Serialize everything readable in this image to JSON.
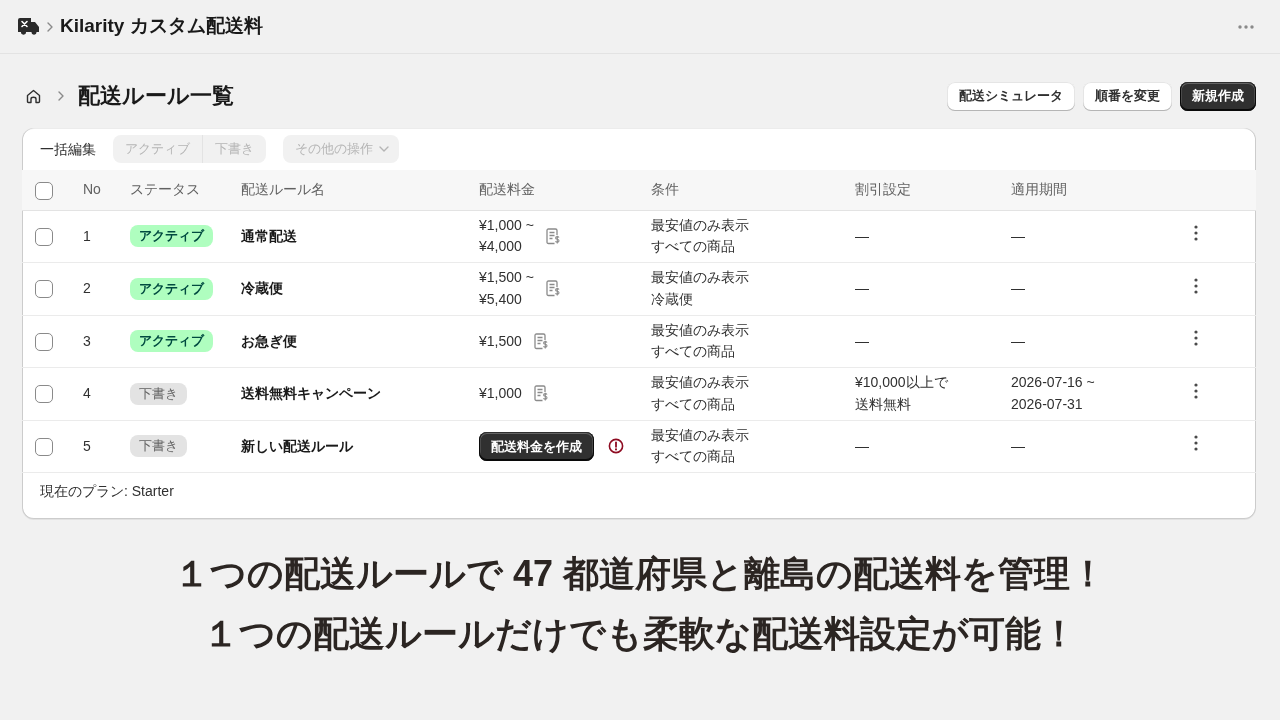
{
  "app_bar": {
    "title": "Kilarity カスタム配送料"
  },
  "page": {
    "title": "配送ルール一覧",
    "actions": [
      {
        "label": "配送シミュレータ",
        "kind": "secondary"
      },
      {
        "label": "順番を変更",
        "kind": "secondary"
      },
      {
        "label": "新規作成",
        "kind": "primary"
      }
    ]
  },
  "bulk_bar": {
    "label": "一括編集",
    "status_buttons": [
      {
        "label": "アクティブ",
        "disabled": true
      },
      {
        "label": "下書き",
        "disabled": true
      }
    ],
    "more_button": {
      "label": "その他の操作",
      "disabled": true
    }
  },
  "table": {
    "select_all": {
      "checked": false
    },
    "columns": [
      "No",
      "ステータス",
      "配送ルール名",
      "配送料金",
      "条件",
      "割引設定",
      "適用期間"
    ],
    "rows": [
      {
        "checked": false,
        "no": "1",
        "status": {
          "label": "アクティブ",
          "kind": "active"
        },
        "name": "通常配送",
        "fee": {
          "kind": "amount",
          "lines": [
            "¥1,000 ~",
            "¥4,000"
          ]
        },
        "conditions": [
          "最安値のみ表示",
          "すべての商品"
        ],
        "discount": [
          "—"
        ],
        "period": [
          "—"
        ]
      },
      {
        "checked": false,
        "no": "2",
        "status": {
          "label": "アクティブ",
          "kind": "active"
        },
        "name": "冷蔵便",
        "fee": {
          "kind": "amount",
          "lines": [
            "¥1,500 ~",
            "¥5,400"
          ]
        },
        "conditions": [
          "最安値のみ表示",
          "冷蔵便"
        ],
        "discount": [
          "—"
        ],
        "period": [
          "—"
        ]
      },
      {
        "checked": false,
        "no": "3",
        "status": {
          "label": "アクティブ",
          "kind": "active"
        },
        "name": "お急ぎ便",
        "fee": {
          "kind": "amount",
          "lines": [
            "¥1,500"
          ]
        },
        "conditions": [
          "最安値のみ表示",
          "すべての商品"
        ],
        "discount": [
          "—"
        ],
        "period": [
          "—"
        ]
      },
      {
        "checked": false,
        "no": "4",
        "status": {
          "label": "下書き",
          "kind": "draft"
        },
        "name": "送料無料キャンペーン",
        "fee": {
          "kind": "amount",
          "lines": [
            "¥1,000"
          ]
        },
        "conditions": [
          "最安値のみ表示",
          "すべての商品"
        ],
        "discount": [
          "¥10,000以上で",
          "送料無料"
        ],
        "period": [
          "2026-07-16 ~",
          "2026-07-31"
        ]
      },
      {
        "checked": false,
        "no": "5",
        "status": {
          "label": "下書き",
          "kind": "draft"
        },
        "name": "新しい配送ルール",
        "fee": {
          "kind": "action",
          "label": "配送料金を作成"
        },
        "conditions": [
          "最安値のみ表示",
          "すべての商品"
        ],
        "discount": [
          "—"
        ],
        "period": [
          "—"
        ]
      }
    ]
  },
  "footer": {
    "plan": "現在のプラン: Starter"
  },
  "caption": {
    "lines": [
      "１つの配送ルールで 47 都道府県と離島の配送料を管理！",
      "１つの配送ルールだけでも柔軟な配送料設定が可能！"
    ]
  }
}
